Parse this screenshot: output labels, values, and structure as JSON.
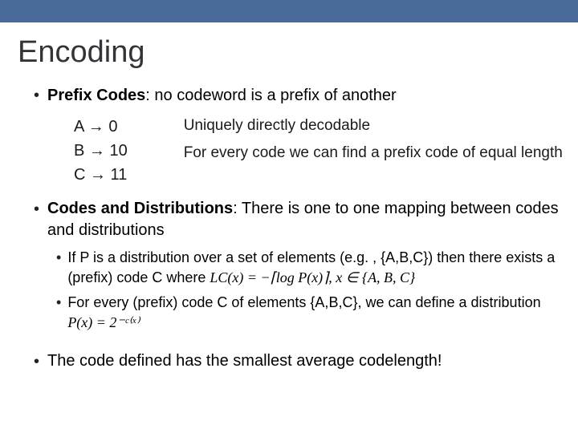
{
  "title": "Encoding",
  "prefix": {
    "label_bold": "Prefix Codes",
    "label_rest": ": no codeword is a prefix of another",
    "codes": {
      "a": "A → 0",
      "b": "B → 10",
      "c": "C → 11"
    },
    "explain1": "Uniquely directly decodable",
    "explain2": "For every code we can find a prefix code of equal length"
  },
  "dist": {
    "label_bold": "Codes and Distributions",
    "label_rest": ": There is one to one mapping between codes and distributions",
    "sub1_a": "If P is a distribution over a set of elements (e.g. , {A,B,C}) then there exists a (prefix) code C where ",
    "sub1_formula": "LC(x) = −⌈log P(x)⌉, x ∈ {A, B, C}",
    "sub2_a": "For every (prefix) code C of elements {A,B,C}, we can define a distribution ",
    "sub2_formula": "P(x) = 2⁻ᶜ⁽ˣ⁾"
  },
  "final": {
    "text": "The code defined has the smallest average codelength!"
  }
}
